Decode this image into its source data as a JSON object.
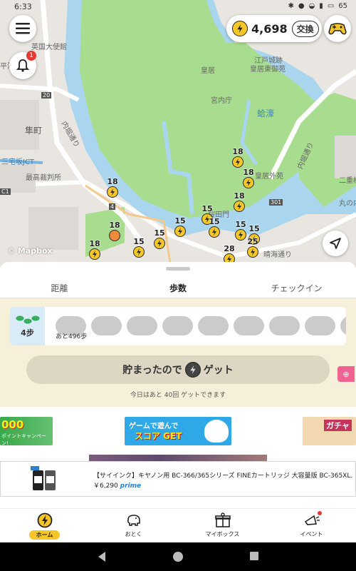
{
  "status_bar": {
    "time": "6:33",
    "battery": "65"
  },
  "map": {
    "attribution": "© Mapbox",
    "labels": [
      {
        "text": "英国大使館",
        "cls": ""
      },
      {
        "text": "皇居",
        "cls": ""
      },
      {
        "text": "江戸城跡",
        "cls": ""
      },
      {
        "text": "皇居東御苑",
        "cls": ""
      },
      {
        "text": "宮内庁",
        "cls": ""
      },
      {
        "text": "蛤濠",
        "cls": "water"
      },
      {
        "text": "隼町",
        "cls": "big"
      },
      {
        "text": "内堀通り",
        "cls": ""
      },
      {
        "text": "三宅坂JCT",
        "cls": "blue"
      },
      {
        "text": "最高裁判所",
        "cls": ""
      },
      {
        "text": "皇居外苑",
        "cls": ""
      },
      {
        "text": "内堀通り",
        "cls": ""
      },
      {
        "text": "二重橋",
        "cls": ""
      },
      {
        "text": "丸の内",
        "cls": ""
      },
      {
        "text": "桜田門",
        "cls": ""
      },
      {
        "text": "晴海通り",
        "cls": ""
      },
      {
        "text": "平河",
        "cls": ""
      },
      {
        "text": "20",
        "cls": ""
      },
      {
        "text": "4",
        "cls": ""
      },
      {
        "text": "301",
        "cls": ""
      },
      {
        "text": "C1",
        "cls": ""
      }
    ],
    "markers": [
      "18",
      "18",
      "18",
      "18",
      "15",
      "15",
      "15",
      "15",
      "15",
      "15",
      "18",
      "18",
      "15",
      "28",
      "25",
      "18",
      "15"
    ]
  },
  "header": {
    "coin_count": "4,698",
    "exchange_label": "交換",
    "notification_count": "1"
  },
  "tabs": [
    {
      "label": "距離",
      "active": false
    },
    {
      "label": "歩数",
      "active": true
    },
    {
      "label": "チェックイン",
      "active": false
    }
  ],
  "steps": {
    "start_label": "4步",
    "remaining": "あと496歩",
    "get_button_before": "貯まったので",
    "get_button_after": "ゲット",
    "note": "今日はあと 40回 ゲットできます"
  },
  "banners": {
    "b1_main": "000",
    "b1_sub": "ポイントキャンペーン!",
    "b2_line1": "ゲームで遊んで",
    "b2_line2": "スコア GET",
    "b3_main": "ガチャ"
  },
  "ad": {
    "title": "【サイインク】キヤノン用 BC-366/365シリーズ FINEカートリッジ 大容量版 BC-365XL...",
    "price": "￥6,290",
    "prime": "prime"
  },
  "bottom_nav": [
    {
      "label": "ホーム",
      "icon": "lightning-coin-icon",
      "active": true
    },
    {
      "label": "おとく",
      "icon": "piggy-bank-icon",
      "active": false
    },
    {
      "label": "マイボックス",
      "icon": "gift-box-icon",
      "active": false
    },
    {
      "label": "イベント",
      "icon": "megaphone-icon",
      "active": false
    }
  ],
  "colors": {
    "accent": "#f6c629",
    "panel": "#f6efd9",
    "park": "#a8dc8e",
    "water": "#a9d6ee"
  }
}
